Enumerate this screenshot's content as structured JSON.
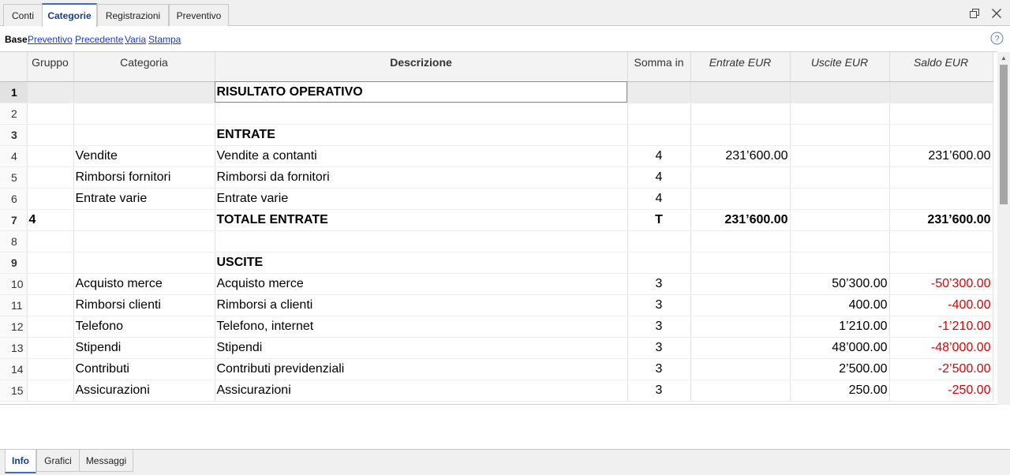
{
  "tabs": [
    {
      "label": "Conti",
      "active": false
    },
    {
      "label": "Categorie",
      "active": true
    },
    {
      "label": "Registrazioni",
      "active": false
    },
    {
      "label": "Preventivo",
      "active": false
    }
  ],
  "window": {
    "restore_icon": "restore-icon",
    "close_icon": "close-icon"
  },
  "views": {
    "base": "Base",
    "links": [
      "Preventivo",
      "Precedente",
      "Varia",
      "Stampa"
    ],
    "help_icon": "help-icon"
  },
  "table": {
    "headers": {
      "rownum": "",
      "gruppo": "Gruppo",
      "categoria": "Categoria",
      "descrizione": "Descrizione",
      "somma": "Somma in",
      "entrate": "Entrate EUR",
      "uscite": "Uscite EUR",
      "saldo": "Saldo EUR"
    },
    "rows": [
      {
        "n": "1",
        "gruppo": "",
        "categoria": "",
        "descrizione": "RISULTATO OPERATIVO",
        "somma": "",
        "entrate": "",
        "uscite": "",
        "saldo": "",
        "bold": true,
        "selected": true
      },
      {
        "n": "2",
        "gruppo": "",
        "categoria": "",
        "descrizione": "",
        "somma": "",
        "entrate": "",
        "uscite": "",
        "saldo": ""
      },
      {
        "n": "3",
        "gruppo": "",
        "categoria": "",
        "descrizione": "ENTRATE",
        "somma": "",
        "entrate": "",
        "uscite": "",
        "saldo": "",
        "bold": true
      },
      {
        "n": "4",
        "gruppo": "",
        "categoria": "Vendite",
        "descrizione": "Vendite a contanti",
        "somma": "4",
        "entrate": "231’600.00",
        "uscite": "",
        "saldo": "231’600.00"
      },
      {
        "n": "5",
        "gruppo": "",
        "categoria": "Rimborsi fornitori",
        "descrizione": "Rimborsi da fornitori",
        "somma": "4",
        "entrate": "",
        "uscite": "",
        "saldo": ""
      },
      {
        "n": "6",
        "gruppo": "",
        "categoria": "Entrate varie",
        "descrizione": "Entrate varie",
        "somma": "4",
        "entrate": "",
        "uscite": "",
        "saldo": ""
      },
      {
        "n": "7",
        "gruppo": "4",
        "categoria": "",
        "descrizione": "TOTALE ENTRATE",
        "somma": "T",
        "entrate": "231’600.00",
        "uscite": "",
        "saldo": "231’600.00",
        "bold": true
      },
      {
        "n": "8",
        "gruppo": "",
        "categoria": "",
        "descrizione": "",
        "somma": "",
        "entrate": "",
        "uscite": "",
        "saldo": ""
      },
      {
        "n": "9",
        "gruppo": "",
        "categoria": "",
        "descrizione": "USCITE",
        "somma": "",
        "entrate": "",
        "uscite": "",
        "saldo": "",
        "bold": true
      },
      {
        "n": "10",
        "gruppo": "",
        "categoria": "Acquisto merce",
        "descrizione": "Acquisto merce",
        "somma": "3",
        "entrate": "",
        "uscite": "50’300.00",
        "saldo": "-50’300.00",
        "negative": true
      },
      {
        "n": "11",
        "gruppo": "",
        "categoria": "Rimborsi clienti",
        "descrizione": "Rimborsi a clienti",
        "somma": "3",
        "entrate": "",
        "uscite": "400.00",
        "saldo": "-400.00",
        "negative": true
      },
      {
        "n": "12",
        "gruppo": "",
        "categoria": "Telefono",
        "descrizione": "Telefono, internet",
        "somma": "3",
        "entrate": "",
        "uscite": "1’210.00",
        "saldo": "-1’210.00",
        "negative": true
      },
      {
        "n": "13",
        "gruppo": "",
        "categoria": "Stipendi",
        "descrizione": "Stipendi",
        "somma": "3",
        "entrate": "",
        "uscite": "48’000.00",
        "saldo": "-48’000.00",
        "negative": true
      },
      {
        "n": "14",
        "gruppo": "",
        "categoria": "Contributi",
        "descrizione": "Contributi previdenziali",
        "somma": "3",
        "entrate": "",
        "uscite": "2’500.00",
        "saldo": "-2’500.00",
        "negative": true
      },
      {
        "n": "15",
        "gruppo": "",
        "categoria": "Assicurazioni",
        "descrizione": "Assicurazioni",
        "somma": "3",
        "entrate": "",
        "uscite": "250.00",
        "saldo": "-250.00",
        "negative": true
      }
    ]
  },
  "bottom_tabs": [
    {
      "label": "Info",
      "active": true
    },
    {
      "label": "Grafici",
      "active": false
    },
    {
      "label": "Messaggi",
      "active": false
    }
  ],
  "colors": {
    "negative": "#e00000",
    "link": "#1a3cc8",
    "active_tab": "#1a3c8a"
  }
}
